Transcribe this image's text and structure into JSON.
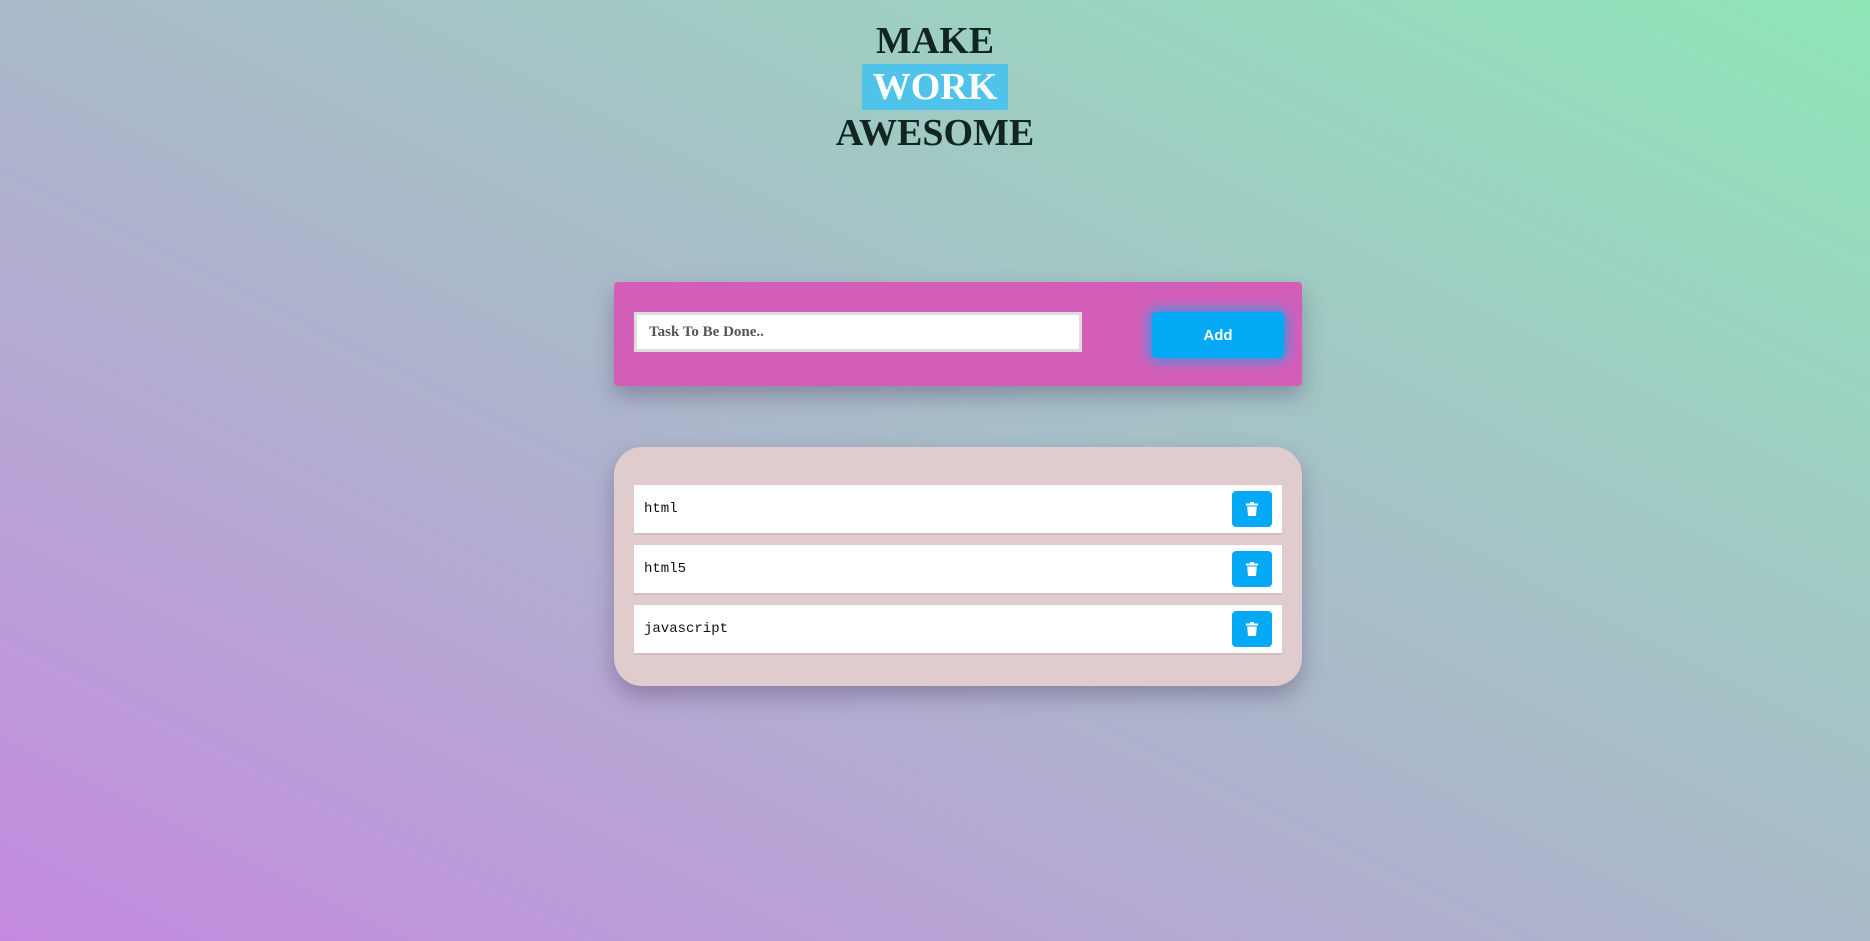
{
  "header": {
    "line1": "MAKE",
    "line2": "WORK",
    "line3": "AWESOME"
  },
  "form": {
    "placeholder": "Task To Be Done..",
    "value": "",
    "add_label": "Add"
  },
  "tasks": [
    {
      "label": "html",
      "delete_icon": "trash-icon"
    },
    {
      "label": "html5",
      "delete_icon": "trash-icon"
    },
    {
      "label": "javascript",
      "delete_icon": "trash-icon"
    }
  ],
  "colors": {
    "highlight": "#4fc3e9",
    "input_panel": "#d35eb8",
    "accent": "#03a9f4",
    "list_panel": "#e0cccc"
  }
}
